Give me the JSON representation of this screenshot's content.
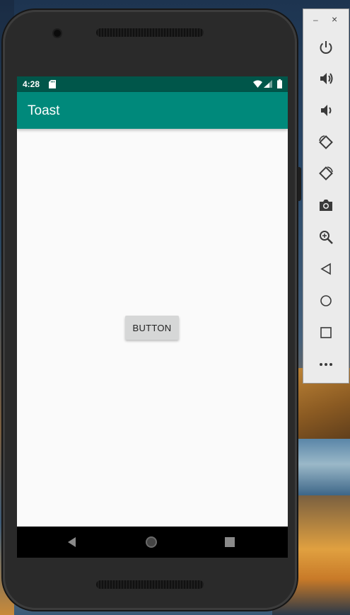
{
  "status_bar": {
    "time": "4:28",
    "icons": [
      "sd-card-icon",
      "wifi-icon",
      "cell-signal-icon",
      "battery-icon"
    ]
  },
  "app_bar": {
    "title": "Toast",
    "color": "#00897b",
    "status_color": "#00564a"
  },
  "content": {
    "button_label": "BUTTON"
  },
  "nav_bar": {
    "items": [
      "back-icon",
      "home-icon",
      "recents-icon"
    ]
  },
  "emulator_toolbar": {
    "window_controls": [
      "minimize",
      "close"
    ],
    "tools": [
      "power",
      "volume-up",
      "volume-down",
      "rotate-left",
      "rotate-right",
      "screenshot",
      "zoom",
      "back",
      "home",
      "overview",
      "more"
    ]
  }
}
